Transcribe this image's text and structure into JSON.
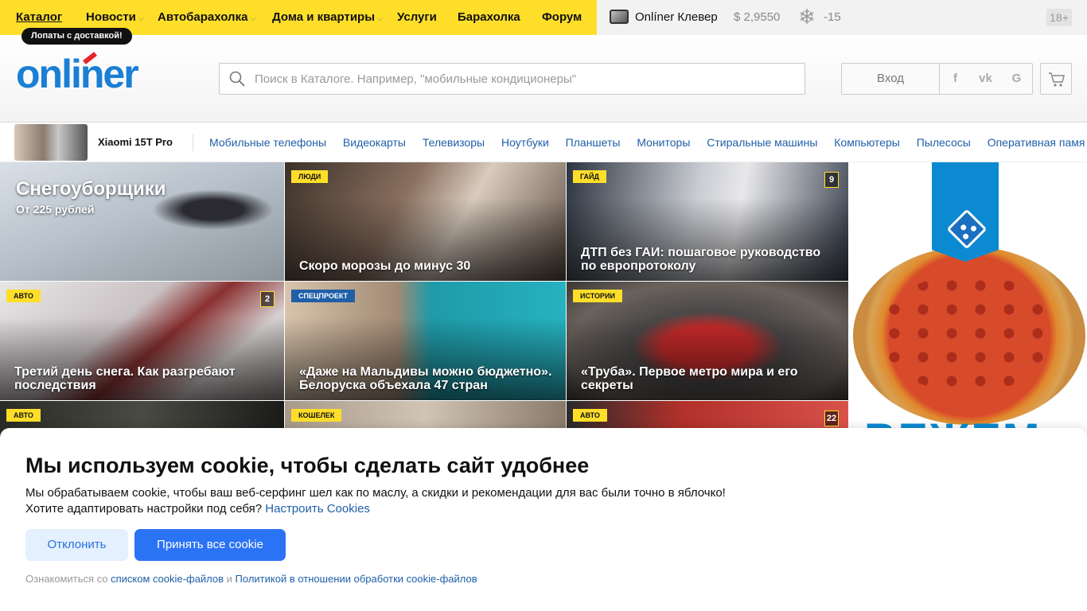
{
  "topnav": {
    "items": [
      {
        "label": "Каталог",
        "active": true
      },
      {
        "label": "Новости",
        "dropdown": true
      },
      {
        "label": "Автобарахолка",
        "dropdown": true
      },
      {
        "label": "Дома и квартиры",
        "dropdown": true
      },
      {
        "label": "Услуги"
      },
      {
        "label": "Барахолка"
      },
      {
        "label": "Форум"
      }
    ],
    "promo": "Лопаты с доставкой!",
    "clever": "Onlíner Клевер",
    "rate": "$ 2,9550",
    "temp": "-15",
    "age": "18+",
    "accent_color": "#ffde2a"
  },
  "header": {
    "logo": "onliner",
    "search_placeholder": "Поиск в Каталоге. Например, \"мобильные кондиционеры\"",
    "login": "Вход",
    "social": [
      "f",
      "vk",
      "G"
    ],
    "icons": {
      "search": "search-icon",
      "cart": "cart-icon"
    }
  },
  "catbar": {
    "promo_title": "Xiaomi 15T Pro",
    "categories": [
      "Мобильные телефоны",
      "Видеокарты",
      "Телевизоры",
      "Ноутбуки",
      "Планшеты",
      "Мониторы",
      "Стиральные машины",
      "Компьютеры",
      "Пылесосы",
      "Оперативная памя"
    ]
  },
  "hero": {
    "title": "Снегоуборщики",
    "subtitle": "От 225 рублей"
  },
  "tiles": [
    {
      "tag": "Люди",
      "title": "Скоро морозы до минус 30"
    },
    {
      "tag": "Гайд",
      "title": "ДТП без ГАИ: пошаговое руководство по европротоколу",
      "count": "9"
    },
    {
      "tag": "Авто",
      "title": "Третий день снега. Как разгребают последствия",
      "count": "2"
    },
    {
      "tag": "Спецпроект",
      "title": "«Даже на Мальдивы можно бюджетно». Белоруска объехала 47 стран"
    },
    {
      "tag": "Истории",
      "title": "«Труба». Первое метро мира и его секреты"
    },
    {
      "tag": "Авто",
      "title": ""
    },
    {
      "tag": "Кошелек",
      "title": ""
    },
    {
      "tag": "Авто",
      "title": "",
      "count": "22"
    }
  ],
  "cookie": {
    "title": "Мы используем cookie, чтобы сделать сайт удобнее",
    "text1": "Мы обрабатываем cookie, чтобы ваш веб-серфинг шел как по маслу, а скидки и рекомендации для вас были точно в яблочко!",
    "text2": "Хотите адаптировать настройки под себя?",
    "settings_link": "Настроить Cookies",
    "decline": "Отклонить",
    "accept": "Принять все cookie",
    "footer_pre": "Ознакомиться со",
    "footer_link1": "списком cookie-файлов",
    "footer_and": "и",
    "footer_link2": "Политикой в отношении обработки cookie-файлов"
  }
}
